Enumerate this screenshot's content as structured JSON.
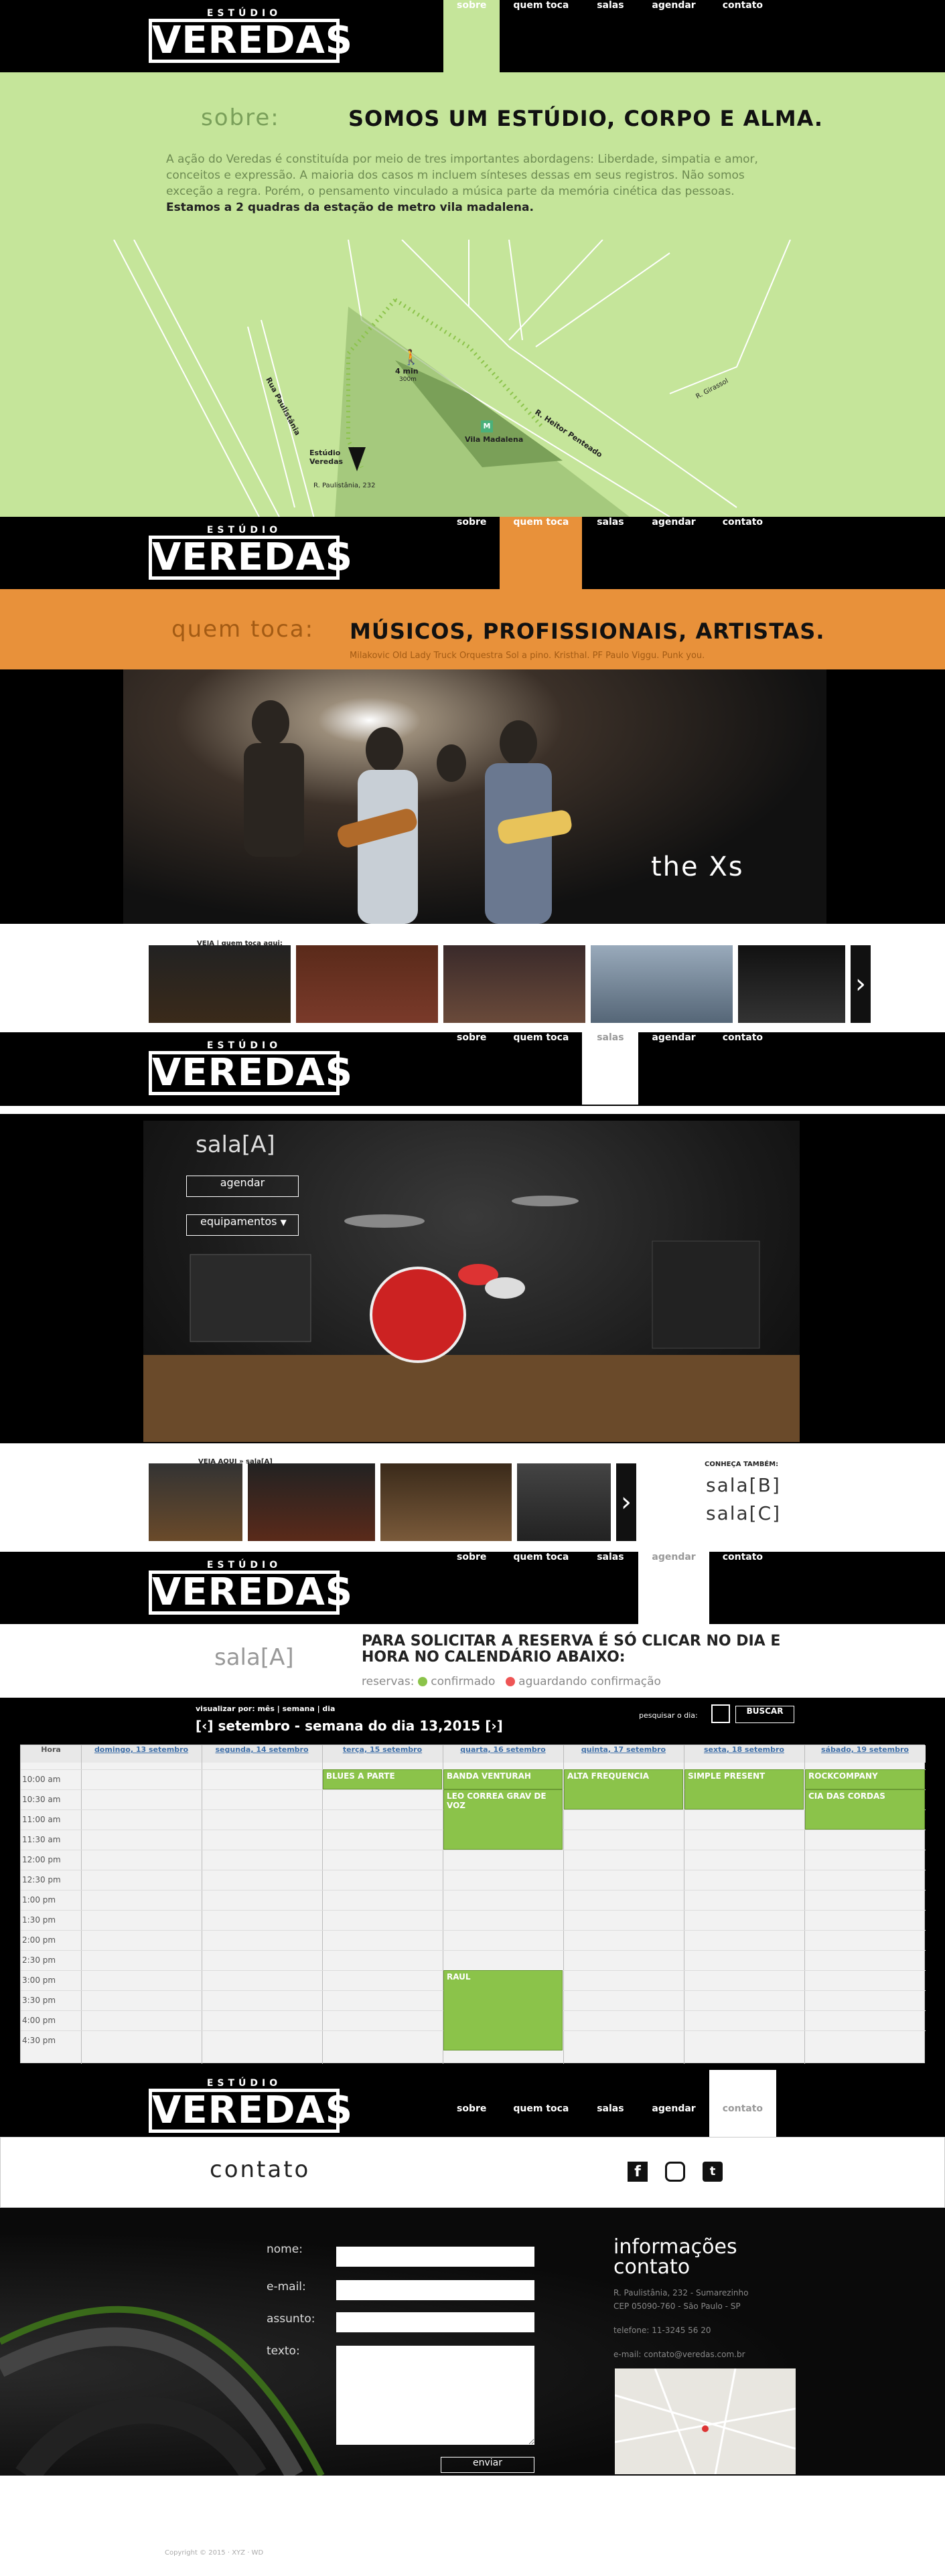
{
  "brand": {
    "top": "ESTÚDIO",
    "name": "VEREDAS"
  },
  "nav": [
    "sobre",
    "quem toca",
    "salas",
    "agendar",
    "contato"
  ],
  "sobre": {
    "label": "sobre:",
    "headline": "SOMOS UM ESTÚDIO, CORPO E ALMA.",
    "text": "A ação do Veredas é constituída por meio de tres importantes abordagens: Liberdade, simpatia e amor, conceitos e expressão. A maioria dos casos m incluem sínteses dessas em seus registros. Não somos exceção a regra. Porém, o pensamento vinculado a música parte da memória cinética das pessoas.",
    "bold": "Estamos a 2 quadras da estação de metro vila madalena.",
    "map": {
      "walk": "4 min",
      "dist": "300m",
      "studio": "Estúdio Veredas",
      "address": "R. Paulistânia, 232",
      "metro": "Vila Madalena",
      "streets": [
        "Rua Paulistânia",
        "R. Heitor Penteado",
        "R. Girassol"
      ]
    }
  },
  "quem": {
    "label": "quem toca:",
    "headline": "MÚSICOS, PROFISSIONAIS, ARTISTAS.",
    "bands": "Milakovic Old Lady Truck Orquestra Sol a pino. Kristhal. PF Paulo Viggu. Punk you.",
    "photo_caption": "the Xs",
    "strip_label": "VEJA | quem toca aqui:"
  },
  "salas": {
    "label": "sala[A]",
    "agendar": "agendar",
    "equip": "equipamentos",
    "strip_label": "VEJA AQUI » sala[A]",
    "conheca": "CONHEÇA TAMBÉM:",
    "others": [
      "sala[B]",
      "sala[C]"
    ]
  },
  "agendar": {
    "label": "sala[A]",
    "headline": "PARA SOLICITAR A RESERVA É SÓ CLICAR NO DIA E HORA NO CALENDÁRIO ABAIXO:",
    "legend_label": "reservas:",
    "confirmed": "confirmado",
    "pending": "aguardando confirmação",
    "view": "visualizar por: mês | semana | dia",
    "week": "[‹] setembro - semana do dia 13,2015 [›]",
    "search_label": "pesquisar o dia:",
    "search_btn": "BUSCAR",
    "hour_header": "Hora",
    "days": [
      "domingo, 13 setembro",
      "segunda, 14 setembro",
      "terça, 15 setembro",
      "quarta, 16 setembro",
      "quinta, 17 setembro",
      "sexta, 18 setembro",
      "sábado, 19 setembro"
    ],
    "hours": [
      "10:00 am",
      "10:30 am",
      "11:00 am",
      "11:30 am",
      "12:00 pm",
      "12:30 pm",
      "1:00 pm",
      "1:30 pm",
      "2:00 pm",
      "2:30 pm",
      "3:00 pm",
      "3:30 pm",
      "4:00 pm",
      "4:30 pm"
    ],
    "events": [
      {
        "day": 2,
        "start": 0,
        "len": 1,
        "name": "BLUES A PARTE"
      },
      {
        "day": 3,
        "start": 0,
        "len": 1,
        "name": "BANDA VENTURAH"
      },
      {
        "day": 3,
        "start": 1,
        "len": 3,
        "name": "LEO CORREA GRAV DE VOZ"
      },
      {
        "day": 3,
        "start": 10,
        "len": 4,
        "name": "RAUL"
      },
      {
        "day": 4,
        "start": 0,
        "len": 2,
        "name": "ALTA FREQUENCIA"
      },
      {
        "day": 5,
        "start": 0,
        "len": 2,
        "name": "SIMPLE PRESENT"
      },
      {
        "day": 6,
        "start": 0,
        "len": 1,
        "name": "ROCKCOMPANY"
      },
      {
        "day": 6,
        "start": 1,
        "len": 2,
        "name": "CIA DAS CORDAS"
      }
    ]
  },
  "contato": {
    "label": "contato",
    "form": {
      "nome": "nome:",
      "email": "e-mail:",
      "assunto": "assunto:",
      "texto": "texto:",
      "enviar": "enviar"
    },
    "info_title": "informações contato",
    "address": "R. Paulistânia, 232 - Sumarezinho",
    "cep": "CEP 05090-760 - São Paulo - SP",
    "phone": "telefone: 11-3245 56 20",
    "email": "e-mail: contato@veredas.com.br",
    "copyright": "Copyright © 2015 · XYZ · WD"
  },
  "colors": {
    "green": "#c5e59a",
    "orange": "#e8913a",
    "accent": "#8bc34a"
  }
}
